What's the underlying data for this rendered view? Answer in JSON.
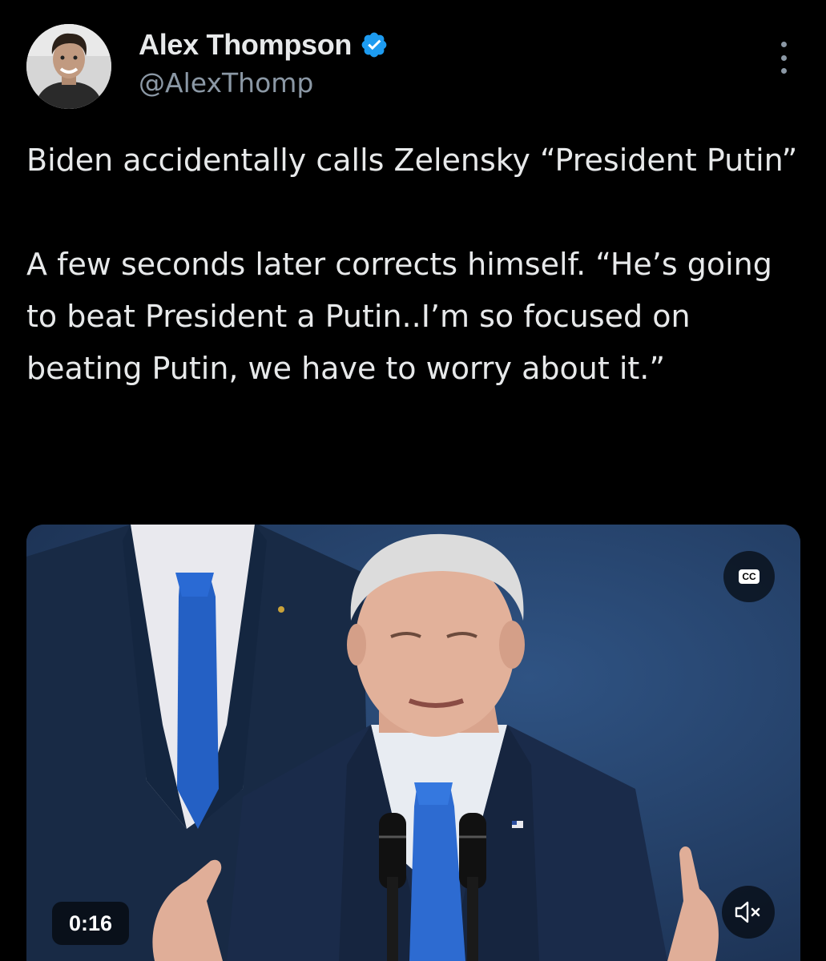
{
  "author": {
    "display_name": "Alex Thompson",
    "handle": "@AlexThomp",
    "verified": true,
    "verified_color": "#1d9bf0"
  },
  "tweet": {
    "text": "Biden accidentally calls Zelensky “President Putin”\n\nA few seconds later corrects himself. “He’s going to beat President a Putin..I’m so focused on beating Putin, we have to worry about it.”"
  },
  "media": {
    "type": "video",
    "duration": "0:16",
    "captions_label": "CC",
    "captions_icon": "closed-captions-icon",
    "mute_icon": "volume-muted-icon"
  },
  "icons": {
    "more": "more-options-icon",
    "verified": "verified-badge-icon"
  }
}
